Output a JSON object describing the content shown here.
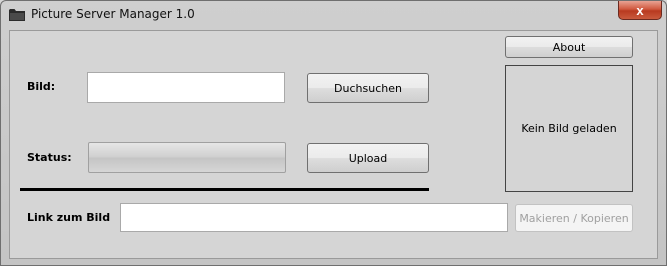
{
  "window": {
    "title": "Picture Server Manager 1.0",
    "close_glyph": "x",
    "icon": "folder-icon"
  },
  "form": {
    "bild_label": "Bild:",
    "bild_value": "",
    "browse_button": "Duchsuchen",
    "status_label": "Status:",
    "upload_button": "Upload",
    "upload_progress": 0,
    "link_label": "Link zum Bild",
    "link_value": "",
    "copy_button": "Makieren / Kopieren",
    "copy_button_enabled": false
  },
  "sidebar": {
    "about_button": "About",
    "preview_text": "Kein Bild geladen"
  },
  "colors": {
    "close_button": "#c9462b",
    "divider": "#000000"
  }
}
